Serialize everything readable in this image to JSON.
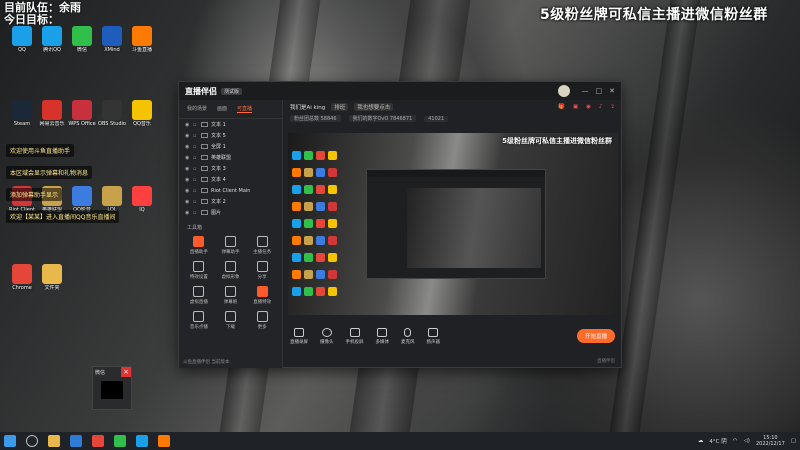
{
  "overlay": {
    "top_left_line1": "目前队伍：余雨",
    "top_left_line2": "今日目标：",
    "top_banner": "5级粉丝牌可私信主播进微信粉丝群"
  },
  "chat_messages": [
    "欢迎使用斗鱼直播助手",
    "本区域会显示弹幕和礼物消息",
    "添加弹幕助手显示",
    "欢迎【某某】进入直播间QQ音乐直播间"
  ],
  "desktop_icons": [
    {
      "label": "QQ",
      "color": "#1aa0e8"
    },
    {
      "label": "腾讯QQ",
      "color": "#1aa0e8"
    },
    {
      "label": "微信",
      "color": "#2fbf4a"
    },
    {
      "label": "XMind",
      "color": "#1e5dbb"
    },
    {
      "label": "斗鱼直播",
      "color": "#ff7a00"
    },
    {
      "label": "Steam",
      "color": "#1b2838"
    },
    {
      "label": "网易云音乐",
      "color": "#d8332a"
    },
    {
      "label": "WPS Office",
      "color": "#c9303d"
    },
    {
      "label": "OBS Studio",
      "color": "#343434"
    },
    {
      "label": "QQ音乐",
      "color": "#f5c400"
    },
    {
      "label": "Riot Client",
      "color": "#d13639"
    },
    {
      "label": "英雄联盟",
      "color": "#c7a24a"
    },
    {
      "label": "QQ影音",
      "color": "#3c7be0"
    },
    {
      "label": "LOL",
      "color": "#c7a24a"
    },
    {
      "label": "IQ",
      "color": "#ff4040"
    },
    {
      "label": "Chrome",
      "color": "#e6463a"
    },
    {
      "label": "文件夹",
      "color": "#e8b84a"
    }
  ],
  "app": {
    "name": "直播伴侣",
    "version": "测试版",
    "left_tabs": [
      "我的场景",
      "画面",
      "可直播"
    ],
    "scenes": [
      "文本 1",
      "文本 5",
      "全屏 1",
      "英雄联盟",
      "文本 3",
      "文本 4",
      "Riot Client Main",
      "文本 2",
      "图片"
    ],
    "tools_title": "工具箱",
    "tools": [
      "直播助手",
      "弹幕助手",
      "主播任务",
      "特效设置",
      "虚拟形象",
      "分享",
      "虚拟直播",
      "弹幕姬",
      "直播特效",
      "音乐点播",
      "下载",
      "更多"
    ],
    "left_footer": "斗鱼直播伴侣 当前版本",
    "right_header": {
      "streamer": "我们是Ai king",
      "tag": "排班",
      "note": "我也想要点击",
      "icons": [
        "gift-icon",
        "bag-icon",
        "live-icon",
        "bell-icon",
        "share-icon"
      ]
    },
    "stats": [
      "粉丝团总数 58846",
      "我们的数字OvO 7846871",
      "41021"
    ],
    "preview_banner": "5级粉丝牌可私信主播进微信粉丝群",
    "bottom_tools": [
      "直播录屏",
      "摄像头",
      "手机投屏",
      "多媒体",
      "麦克风",
      "扬声器"
    ],
    "start_label": "开始直播",
    "status_left": "",
    "status_right": "直播伴侣"
  },
  "popup": {
    "title": "微信"
  },
  "taskbar": {
    "weather": "4°C 阴",
    "time": "15:10",
    "date": "2022/12/17"
  }
}
